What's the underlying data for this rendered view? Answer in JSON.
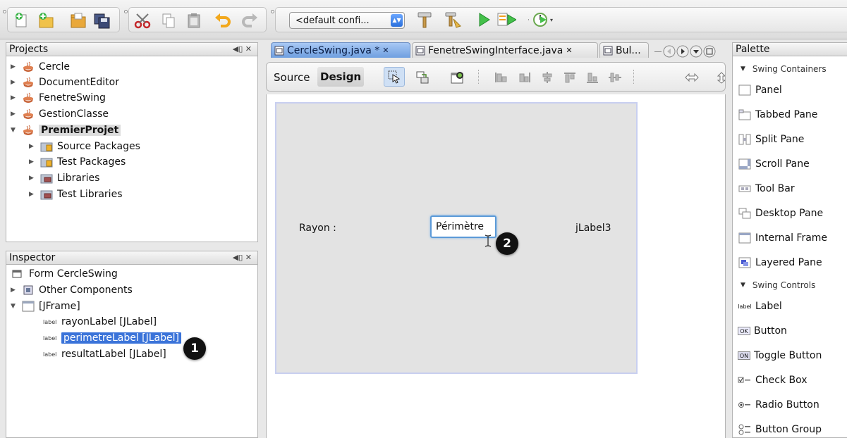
{
  "toolbar": {
    "config_label": "<default confi...",
    "config_arrow": "▲▼"
  },
  "projects": {
    "title": "Projects",
    "controls": "◀▯ ✕",
    "items": [
      {
        "label": "Cercle"
      },
      {
        "label": "DocumentEditor"
      },
      {
        "label": "FenetreSwing"
      },
      {
        "label": "GestionClasse"
      },
      {
        "label": "PremierProjet"
      },
      {
        "label": "Source Packages"
      },
      {
        "label": "Test Packages"
      },
      {
        "label": "Libraries"
      },
      {
        "label": "Test Libraries"
      }
    ]
  },
  "inspector": {
    "title": "Inspector",
    "controls": "◀▯ ✕",
    "items": [
      {
        "label": "Form CercleSwing"
      },
      {
        "label": "Other Components"
      },
      {
        "label": "[JFrame]"
      },
      {
        "label": "rayonLabel [JLabel]",
        "tag": "label"
      },
      {
        "label": "perimetreLabel [JLabel]",
        "tag": "label"
      },
      {
        "label": "resultatLabel [JLabel]",
        "tag": "label"
      }
    ]
  },
  "editor": {
    "tabs": [
      {
        "label": "CercleSwing.java *"
      },
      {
        "label": "FenetreSwingInterface.java"
      },
      {
        "label": "Bul..."
      }
    ],
    "source_label": "Source",
    "design_label": "Design",
    "form": {
      "rayon_label": "Rayon :",
      "perimetre_label": "Périmètre",
      "jlabel3": "jLabel3"
    }
  },
  "callouts": {
    "one": "1",
    "two": "2"
  },
  "palette": {
    "title": "Palette",
    "containers_title": "Swing Containers",
    "containers": [
      "Panel",
      "Tabbed Pane",
      "Split Pane",
      "Scroll Pane",
      "Tool Bar",
      "Desktop Pane",
      "Internal Frame",
      "Layered Pane"
    ],
    "controls_title": "Swing Controls",
    "controls": [
      {
        "label": "Label",
        "icon_text": "label"
      },
      {
        "label": "Button",
        "icon_text": "OK"
      },
      {
        "label": "Toggle Button",
        "icon_text": "ON"
      },
      {
        "label": "Check Box",
        "icon_text": ""
      },
      {
        "label": "Radio Button",
        "icon_text": ""
      },
      {
        "label": "Button Group",
        "icon_text": ""
      }
    ]
  },
  "colors": {
    "selection": "#3a73d9",
    "active_tab": "#8fb6ec",
    "design_frame": "#e3e3e3"
  }
}
